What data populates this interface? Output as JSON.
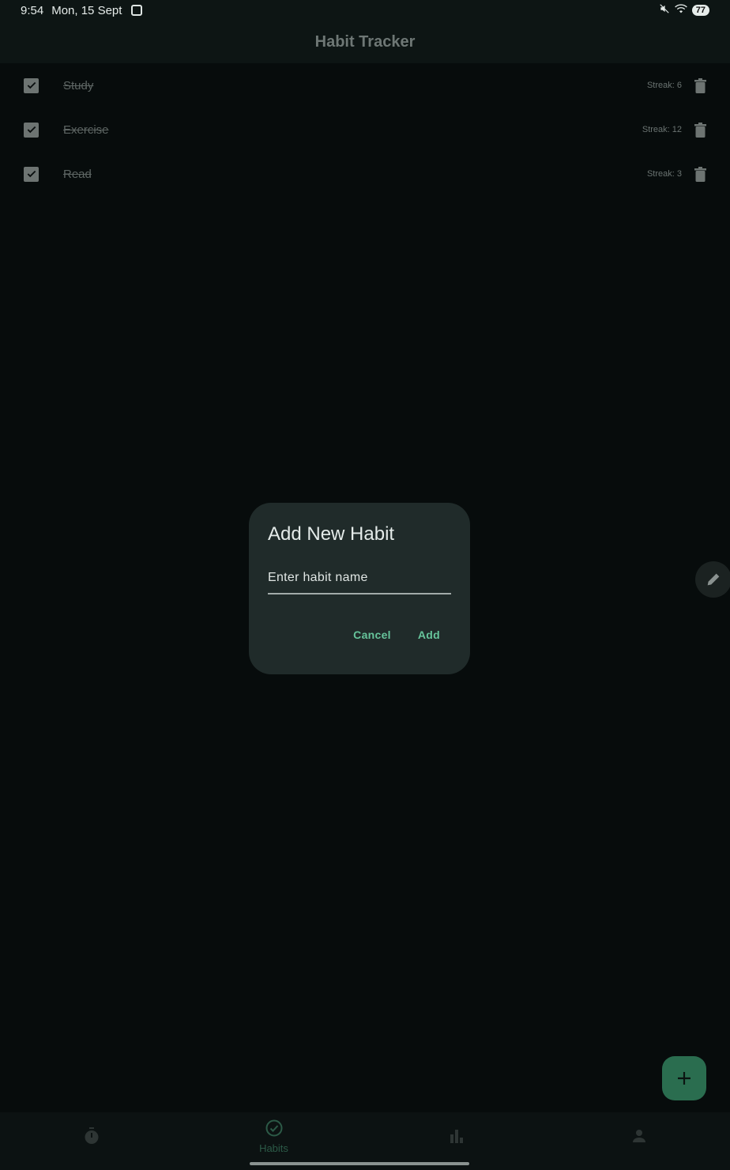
{
  "status_bar": {
    "time": "9:54",
    "date": "Mon, 15 Sept",
    "battery": "77"
  },
  "app_bar": {
    "title": "Habit Tracker"
  },
  "habits": [
    {
      "name": "Study",
      "streak": "Streak: 6",
      "done": true
    },
    {
      "name": "Exercise",
      "streak": "Streak: 12",
      "done": true
    },
    {
      "name": "Read",
      "streak": "Streak: 3",
      "done": true
    }
  ],
  "dialog": {
    "title": "Add New Habit",
    "input_placeholder": "Enter habit name",
    "input_value": "",
    "cancel_label": "Cancel",
    "add_label": "Add"
  },
  "bottom_nav": {
    "items": [
      {
        "icon": "timer-icon",
        "label": ""
      },
      {
        "icon": "check-circle-icon",
        "label": "Habits",
        "active": true
      },
      {
        "icon": "bar-chart-icon",
        "label": ""
      },
      {
        "icon": "person-icon",
        "label": ""
      }
    ]
  },
  "colors": {
    "accent": "#66c49b",
    "fab": "#2a6d4f",
    "background": "#070c0c",
    "dialog": "#202b2a"
  }
}
